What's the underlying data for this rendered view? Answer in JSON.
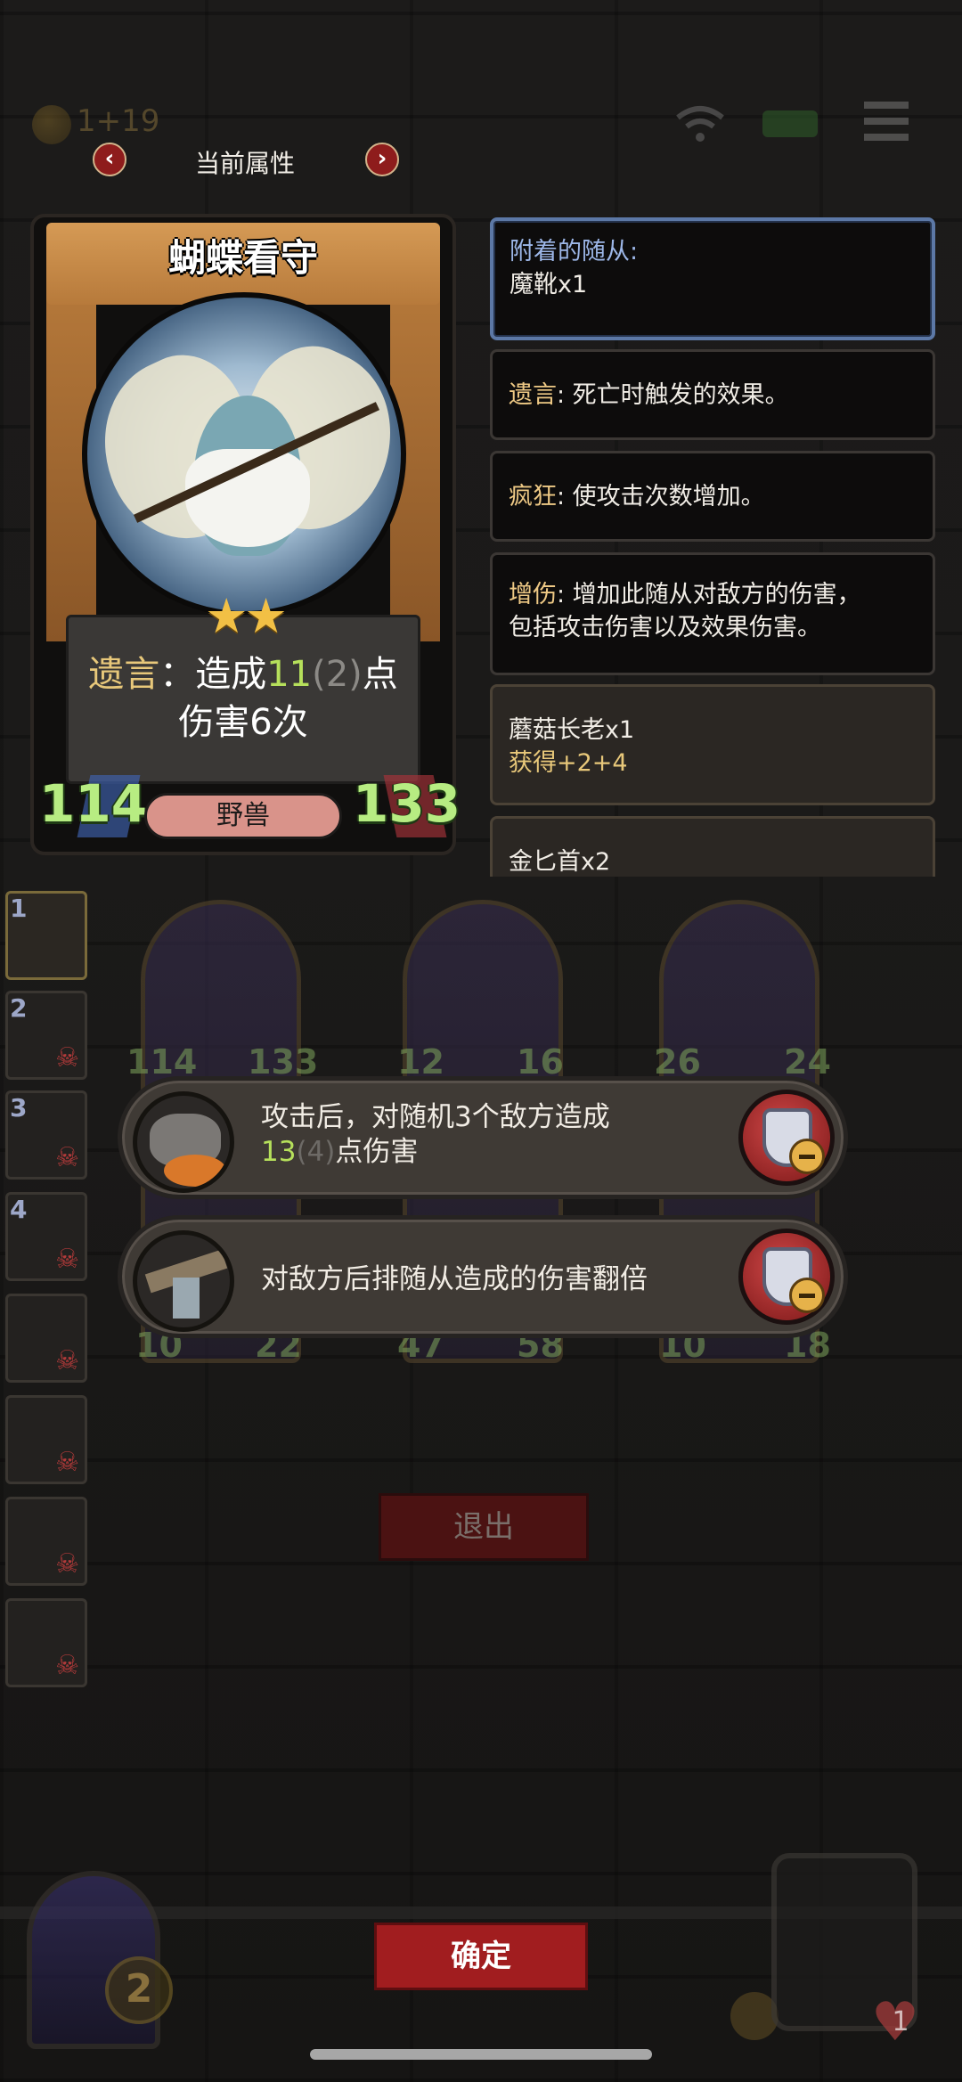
{
  "hud": {
    "coin_text": "1+19"
  },
  "header": {
    "title": "当前属性",
    "prev_icon": "chevron-left-icon",
    "next_icon": "chevron-right-icon"
  },
  "card": {
    "name": "蝴蝶看守",
    "stars": "★★",
    "star_count": 2,
    "desc_keyword": "遗言",
    "desc_colon": "：",
    "desc_part1": "造成",
    "desc_num": "11",
    "desc_bonus": "(2)",
    "desc_part2": "点",
    "desc_line2": "伤害6次",
    "attack": "114",
    "health": "133",
    "type": "野兽"
  },
  "info_panels": {
    "attached_label": "附着的随从:",
    "attached_value": "魔靴x1",
    "deathrattle_kw": "遗言",
    "deathrattle_text": ": 死亡时触发的效果。",
    "frenzy_kw": "疯狂",
    "frenzy_text": ": 使攻击次数增加。",
    "dmgup_kw": "增伤",
    "dmgup_text": ": 增加此随从对敌方的伤害，",
    "dmgup_text2": "包括攻击伤害以及效果伤害。",
    "item1_name": "蘑菇长老x1",
    "item1_gain": "获得+2+4",
    "item2_name": "金匕首x2"
  },
  "roster": {
    "slots": [
      "1",
      "2",
      "3",
      "4",
      "",
      "",
      "",
      ""
    ]
  },
  "minions": [
    {
      "atk": "114",
      "hp": "133",
      "atk2": "10",
      "hp2": "22"
    },
    {
      "atk": "12",
      "hp": "16",
      "atk2": "47",
      "hp2": "58"
    },
    {
      "atk": "26",
      "hp": "24",
      "atk2": "10",
      "hp2": "18"
    }
  ],
  "abilities": [
    {
      "line1": "攻击后，对随机3个敌方造成",
      "num": "13",
      "dim": "(4)",
      "line2_rest": "点伤害"
    },
    {
      "line1": "对敌方后排随从造成的伤害翻倍"
    }
  ],
  "buttons": {
    "exit": "退出",
    "confirm": "确定"
  },
  "bottom": {
    "portal_badge": "2",
    "heart_value": "1"
  },
  "colors": {
    "accent_red": "#a11d1f",
    "keyword_gold": "#e8c87a",
    "stat_green": "#b7ec82",
    "selected_border": "#5c78a6"
  }
}
